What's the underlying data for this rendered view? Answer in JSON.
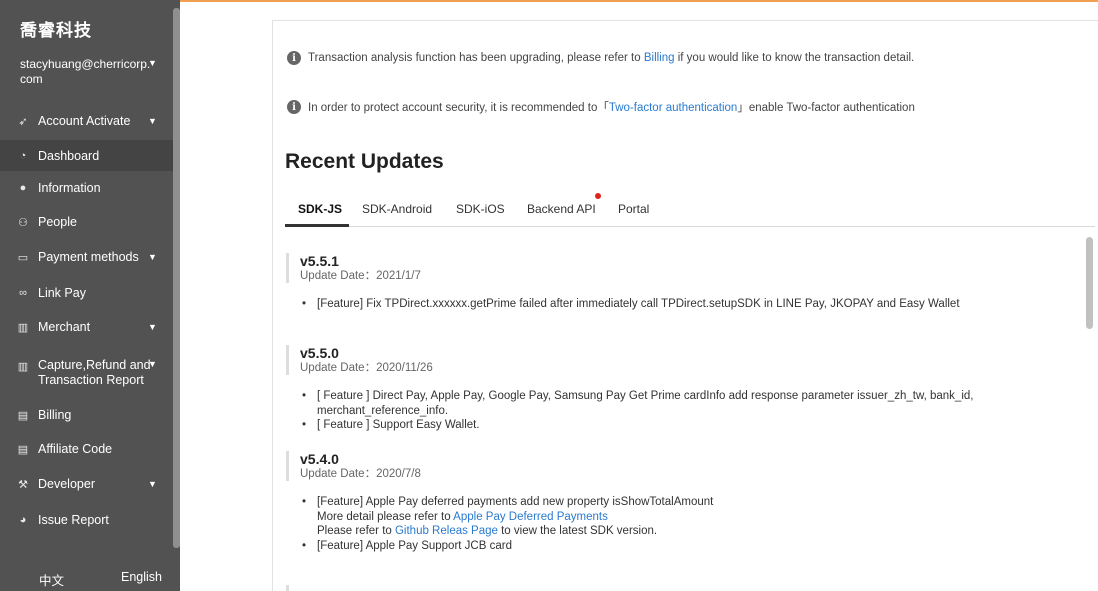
{
  "sidebar": {
    "brand": "喬睿科技",
    "user_line1": "stacyhuang@cherricorp.",
    "user_line2": "com",
    "items": [
      {
        "icon": "rocket-icon",
        "glyph": "➶",
        "label": "Account Activate",
        "caret": true
      },
      {
        "icon": "dashboard-icon",
        "glyph": "◔",
        "label": "Dashboard",
        "caret": false,
        "active": true
      },
      {
        "icon": "info-icon",
        "glyph": "●",
        "label": "Information",
        "caret": false
      },
      {
        "icon": "people-icon",
        "glyph": "⚇",
        "label": "People",
        "caret": false
      },
      {
        "icon": "credit-card-icon",
        "glyph": "▭",
        "label": "Payment methods",
        "caret": true
      },
      {
        "icon": "link-icon",
        "glyph": "∞",
        "label": "Link Pay",
        "caret": false
      },
      {
        "icon": "building-icon",
        "glyph": "▥",
        "label": "Merchant",
        "caret": true
      },
      {
        "icon": "building-icon",
        "glyph": "▥",
        "label": "Capture,Refund and",
        "label2": "Transaction Report",
        "caret": true
      },
      {
        "icon": "billing-icon",
        "glyph": "▤",
        "label": "Billing",
        "caret": false
      },
      {
        "icon": "affiliate-icon",
        "glyph": "▤",
        "label": "Affiliate Code",
        "caret": false
      },
      {
        "icon": "wrench-icon",
        "glyph": "⚒",
        "label": "Developer",
        "caret": true
      },
      {
        "icon": "issue-icon",
        "glyph": "◕",
        "label": "Issue Report",
        "caret": false
      }
    ],
    "lang_zh": "中文",
    "lang_en": "English"
  },
  "notices": {
    "n1_before": "Transaction analysis function has been upgrading, please refer to ",
    "n1_link": "Billing",
    "n1_after": " if you would like to know the transaction detail.",
    "n2_before": "In order to protect account security, it is recommended to「",
    "n2_link": "Two-factor authentication",
    "n2_after": "」enable Two-factor authentication"
  },
  "main": {
    "title": "Recent Updates",
    "tabs": [
      "SDK-JS",
      "SDK-Android",
      "SDK-iOS",
      "Backend API",
      "Portal"
    ]
  },
  "releases": [
    {
      "version": "v5.5.1",
      "date": "Update Date：2021/1/7",
      "b1": "[Feature] Fix TPDirect.xxxxxx.getPrime failed after immediately call TPDirect.setupSDK in LINE Pay, JKOPAY and Easy Wallet"
    },
    {
      "version": "v5.5.0",
      "date": "Update Date：2020/11/26",
      "b1": "[ Feature ] Direct Pay, Apple Pay, Google Pay, Samsung Pay Get Prime cardInfo add response parameter issuer_zh_tw, bank_id, merchant_reference_info.",
      "b2": "[ Feature ] Support Easy Wallet."
    },
    {
      "version": "v5.4.0",
      "date": "Update Date：2020/7/8",
      "b1": "[Feature] Apple Pay deferred payments add new property isShowTotalAmount",
      "b1_more_before": "More detail please refer to ",
      "b1_more_link": "Apple Pay Deferred Payments",
      "b1_refer_before": "Please refer to ",
      "b1_refer_link": "Github Releas Page",
      "b1_refer_after": " to view the latest SDK version.",
      "b2": "[Feature] Apple Pay Support JCB card"
    }
  ]
}
